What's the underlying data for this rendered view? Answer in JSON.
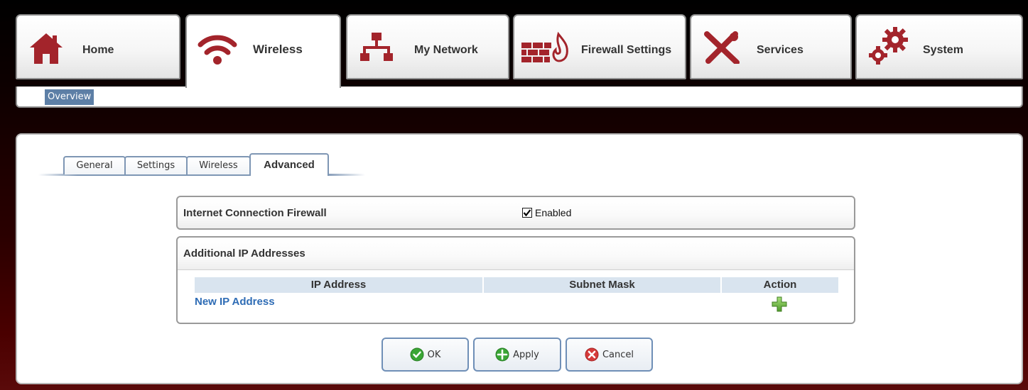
{
  "nav": {
    "tabs": [
      {
        "label": "Home",
        "icon": "home-icon"
      },
      {
        "label": "Wireless",
        "icon": "wifi-icon"
      },
      {
        "label": "My Network",
        "icon": "network-icon"
      },
      {
        "label": "Firewall Settings",
        "icon": "firewall-icon"
      },
      {
        "label": "Services",
        "icon": "tools-icon"
      },
      {
        "label": "System",
        "icon": "gears-icon"
      }
    ],
    "active_tab": "Wireless",
    "subnav": {
      "item": "Overview"
    }
  },
  "subtabs": {
    "items": [
      "General",
      "Settings",
      "Wireless",
      "Advanced"
    ],
    "active": "Advanced"
  },
  "firewall": {
    "label": "Internet Connection Firewall",
    "checkbox_label": "Enabled",
    "checked": true
  },
  "additional_ips": {
    "title": "Additional IP Addresses",
    "columns": [
      "IP Address",
      "Subnet Mask",
      "Action"
    ],
    "new_link": "New IP Address",
    "add_icon": "add-icon"
  },
  "buttons": {
    "ok": "OK",
    "apply": "Apply",
    "cancel": "Cancel"
  },
  "colors": {
    "icon_red": "#a3242b",
    "accent_blue": "#5d7fa6",
    "link_blue": "#2e6cb5",
    "header_cell": "#d9e4ef",
    "ok_green": "#3aa635",
    "cancel_red": "#d63a3a"
  }
}
